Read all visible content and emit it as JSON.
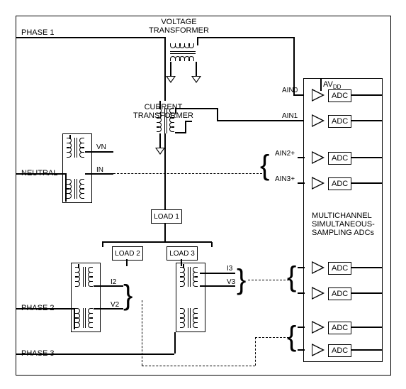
{
  "title": {
    "voltage_transformer": "VOLTAGE\nTRANSFORMER",
    "current_transformer": "CURRENT\nTRANSFORMER"
  },
  "phases": {
    "phase1": "PHASE 1",
    "phase2": "PHASE 2",
    "phase3": "PHASE 3",
    "neutral": "NEUTRAL"
  },
  "signals": {
    "vn": "VN",
    "in": "IN",
    "v2": "V2",
    "i2": "I2",
    "v3": "V3",
    "i3": "I3"
  },
  "loads": {
    "load1": "LOAD 1",
    "load2": "LOAD 2",
    "load3": "LOAD 3"
  },
  "adc_block": {
    "title": "MULTICHANNEL\nSIMULTANEOUS-\nSAMPLING ADCs",
    "avdd": "AV",
    "avdd_sub": "DD",
    "ain0": "AIN0",
    "ain1": "AIN1",
    "ain2p": "AIN2+",
    "ain3p": "AIN3+",
    "adc_label": "ADC"
  }
}
